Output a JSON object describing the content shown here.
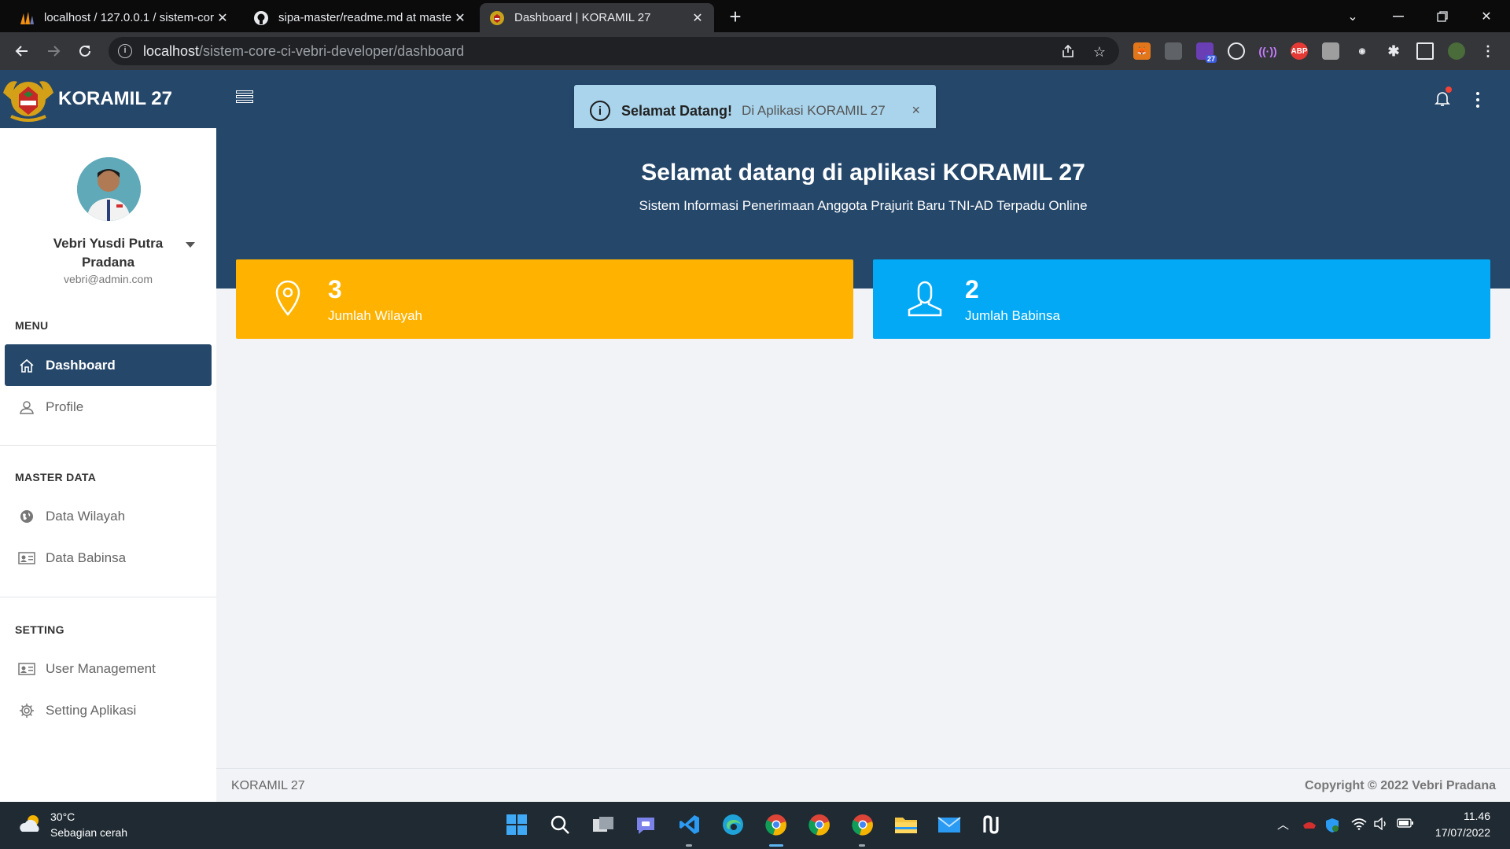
{
  "browser": {
    "tabs": [
      {
        "title": "localhost / 127.0.0.1 / sistem-cor",
        "active": false
      },
      {
        "title": "sipa-master/readme.md at maste",
        "active": false
      },
      {
        "title": "Dashboard | KORAMIL 27",
        "active": true
      }
    ],
    "url_host": "localhost",
    "url_path": "/sistem-core-ci-vebri-developer/dashboard",
    "extension_badges": {
      "calendar": "27",
      "adblock": "ABP"
    }
  },
  "app": {
    "brand": "KORAMIL 27",
    "toast": {
      "title": "Selamat Datang!",
      "message": "Di Aplikasi KORAMIL 27",
      "close": "×"
    },
    "user": {
      "name": "Vebri Yusdi Putra Pradana",
      "email": "vebri@admin.com"
    },
    "nav": {
      "menu_header": "MENU",
      "dashboard": "Dashboard",
      "profile": "Profile",
      "master_header": "MASTER DATA",
      "data_wilayah": "Data Wilayah",
      "data_babinsa": "Data Babinsa",
      "setting_header": "SETTING",
      "user_management": "User Management",
      "setting_aplikasi": "Setting Aplikasi"
    },
    "hero": {
      "title": "Selamat datang di aplikasi KORAMIL 27",
      "subtitle": "Sistem Informasi Penerimaan Anggota Prajurit Baru TNI-AD Terpadu Online"
    },
    "stats": [
      {
        "value": "3",
        "label": "Jumlah Wilayah",
        "color": "#ffb300"
      },
      {
        "value": "2",
        "label": "Jumlah Babinsa",
        "color": "#03a9f4"
      }
    ],
    "footer": {
      "left": "KORAMIL 27",
      "right": "Copyright © 2022 Vebri Pradana"
    },
    "colors": {
      "header": "#25476a",
      "accent_yellow": "#ffb300",
      "accent_blue": "#03a9f4"
    }
  },
  "taskbar": {
    "weather_temp": "30°C",
    "weather_desc": "Sebagian cerah",
    "time": "11.46",
    "date": "17/07/2022"
  }
}
